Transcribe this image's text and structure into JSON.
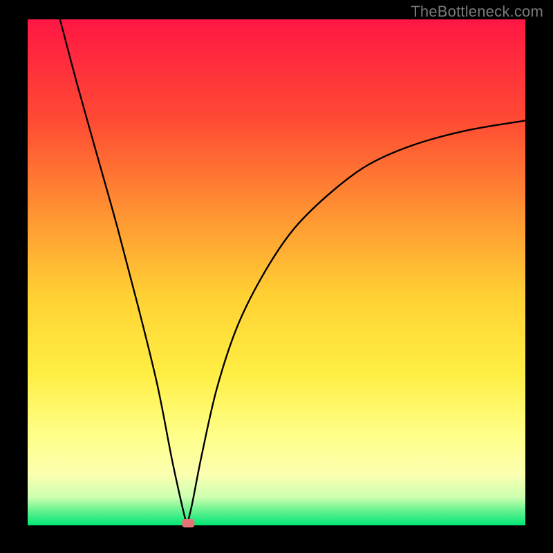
{
  "watermark": "TheBottleneck.com",
  "chart_area": {
    "outer_w": 800,
    "outer_h": 800,
    "inner_x": 40,
    "inner_y": 28,
    "inner_w": 720,
    "inner_h": 732
  },
  "chart_data": {
    "type": "line",
    "title": "",
    "xlabel": "",
    "ylabel": "",
    "x_range": [
      0,
      100
    ],
    "y_range": [
      0,
      100
    ],
    "background": {
      "description": "vertical gradient red→orange→yellow→pale-yellow→green with thin green band at bottom",
      "stops": [
        {
          "offset": 0.0,
          "color": "#ff1744"
        },
        {
          "offset": 0.2,
          "color": "#ff4b33"
        },
        {
          "offset": 0.4,
          "color": "#ff9a33"
        },
        {
          "offset": 0.55,
          "color": "#ffd233"
        },
        {
          "offset": 0.7,
          "color": "#ffee44"
        },
        {
          "offset": 0.82,
          "color": "#ffff88"
        },
        {
          "offset": 0.9,
          "color": "#fbffb0"
        },
        {
          "offset": 0.945,
          "color": "#ccffb0"
        },
        {
          "offset": 0.965,
          "color": "#7cf595"
        },
        {
          "offset": 1.0,
          "color": "#00e676"
        }
      ]
    },
    "min_marker": {
      "x": 32,
      "y": 0,
      "color": "#e57373",
      "shape": "rounded-square"
    },
    "series": [
      {
        "name": "left-branch",
        "description": "steep near-linear descent from top-left to the minimum",
        "points": [
          {
            "x": 6.5,
            "y": 100
          },
          {
            "x": 10,
            "y": 87
          },
          {
            "x": 14,
            "y": 73
          },
          {
            "x": 18,
            "y": 59
          },
          {
            "x": 22,
            "y": 44
          },
          {
            "x": 26,
            "y": 28
          },
          {
            "x": 29,
            "y": 13
          },
          {
            "x": 31,
            "y": 4
          },
          {
            "x": 32,
            "y": 0
          }
        ]
      },
      {
        "name": "right-branch",
        "description": "rise from the minimum, decelerating toward ~80 at right edge",
        "points": [
          {
            "x": 32,
            "y": 0
          },
          {
            "x": 33,
            "y": 4
          },
          {
            "x": 35,
            "y": 14
          },
          {
            "x": 38,
            "y": 27
          },
          {
            "x": 42,
            "y": 39
          },
          {
            "x": 47,
            "y": 49
          },
          {
            "x": 53,
            "y": 58
          },
          {
            "x": 60,
            "y": 65
          },
          {
            "x": 68,
            "y": 71
          },
          {
            "x": 77,
            "y": 75
          },
          {
            "x": 88,
            "y": 78
          },
          {
            "x": 100,
            "y": 80
          }
        ]
      }
    ]
  }
}
